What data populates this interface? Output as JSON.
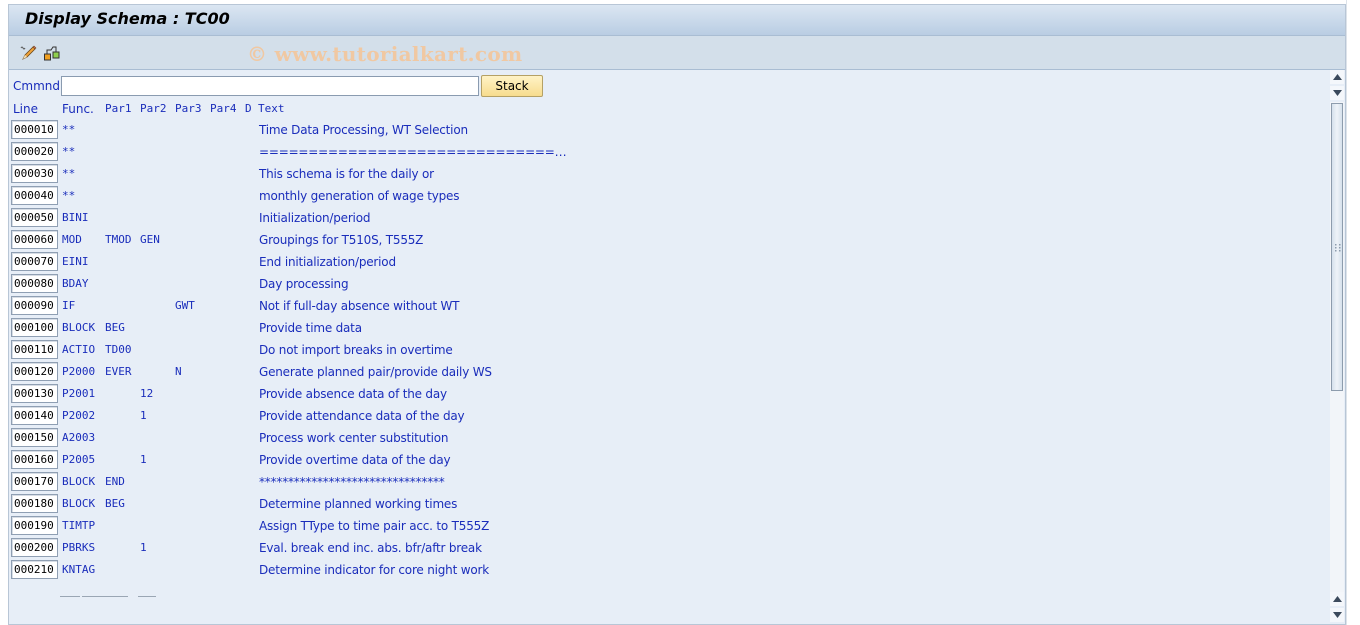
{
  "window": {
    "title": "Display Schema : TC00",
    "watermark": "© www.tutorialkart.com"
  },
  "toolbar": {
    "icons": [
      "edit-pencil-icon",
      "hierarchy-structure-icon"
    ]
  },
  "command": {
    "label": "Cmmnd",
    "value": "",
    "placeholder": "",
    "stack_button": "Stack"
  },
  "table": {
    "headers": {
      "line": "Line",
      "func": "Func.",
      "par1": "Par1",
      "par2": "Par2",
      "par3": "Par3",
      "par4": "Par4",
      "d": "D",
      "text": "Text"
    },
    "rows": [
      {
        "line": "000010",
        "func": "**",
        "par1": "",
        "par2": "",
        "par3": "",
        "par4": "",
        "d": "",
        "text": "Time Data Processing, WT Selection"
      },
      {
        "line": "000020",
        "func": "**",
        "par1": "",
        "par2": "",
        "par3": "",
        "par4": "",
        "d": "",
        "text": "==============================…"
      },
      {
        "line": "000030",
        "func": "**",
        "par1": "",
        "par2": "",
        "par3": "",
        "par4": "",
        "d": "",
        "text": "This schema is for the daily or"
      },
      {
        "line": "000040",
        "func": "**",
        "par1": "",
        "par2": "",
        "par3": "",
        "par4": "",
        "d": "",
        "text": "monthly generation of wage types"
      },
      {
        "line": "000050",
        "func": "BINI",
        "par1": "",
        "par2": "",
        "par3": "",
        "par4": "",
        "d": "",
        "text": "Initialization/period"
      },
      {
        "line": "000060",
        "func": "MOD",
        "par1": "TMOD",
        "par2": "GEN",
        "par3": "",
        "par4": "",
        "d": "",
        "text": "Groupings for T510S, T555Z"
      },
      {
        "line": "000070",
        "func": "EINI",
        "par1": "",
        "par2": "",
        "par3": "",
        "par4": "",
        "d": "",
        "text": "End initialization/period"
      },
      {
        "line": "000080",
        "func": "BDAY",
        "par1": "",
        "par2": "",
        "par3": "",
        "par4": "",
        "d": "",
        "text": "Day processing"
      },
      {
        "line": "000090",
        "func": "IF",
        "par1": "",
        "par2": "",
        "par3": "GWT",
        "par4": "",
        "d": "",
        "text": "Not if full-day absence without WT"
      },
      {
        "line": "000100",
        "func": "BLOCK",
        "par1": "BEG",
        "par2": "",
        "par3": "",
        "par4": "",
        "d": "",
        "text": "Provide time data"
      },
      {
        "line": "000110",
        "func": "ACTIO",
        "par1": "TD00",
        "par2": "",
        "par3": "",
        "par4": "",
        "d": "",
        "text": "Do not import breaks in overtime"
      },
      {
        "line": "000120",
        "func": "P2000",
        "par1": "EVER",
        "par2": "",
        "par3": "N",
        "par4": "",
        "d": "",
        "text": "Generate planned pair/provide daily WS"
      },
      {
        "line": "000130",
        "func": "P2001",
        "par1": "",
        "par2": "12",
        "par3": "",
        "par4": "",
        "d": "",
        "text": "Provide absence data of the day"
      },
      {
        "line": "000140",
        "func": "P2002",
        "par1": "",
        "par2": "1",
        "par3": "",
        "par4": "",
        "d": "",
        "text": "Provide attendance data of the day"
      },
      {
        "line": "000150",
        "func": "A2003",
        "par1": "",
        "par2": "",
        "par3": "",
        "par4": "",
        "d": "",
        "text": "Process work center substitution"
      },
      {
        "line": "000160",
        "func": "P2005",
        "par1": "",
        "par2": "1",
        "par3": "",
        "par4": "",
        "d": "",
        "text": "Provide overtime data of the day"
      },
      {
        "line": "000170",
        "func": "BLOCK",
        "par1": "END",
        "par2": "",
        "par3": "",
        "par4": "",
        "d": "",
        "text": "********************************"
      },
      {
        "line": "000180",
        "func": "BLOCK",
        "par1": "BEG",
        "par2": "",
        "par3": "",
        "par4": "",
        "d": "",
        "text": "Determine planned working times"
      },
      {
        "line": "000190",
        "func": "TIMTP",
        "par1": "",
        "par2": "",
        "par3": "",
        "par4": "",
        "d": "",
        "text": "Assign TType to time pair acc. to T555Z"
      },
      {
        "line": "000200",
        "func": "PBRKS",
        "par1": "",
        "par2": "1",
        "par3": "",
        "par4": "",
        "d": "",
        "text": "Eval. break end inc. abs. bfr/aftr break"
      },
      {
        "line": "000210",
        "func": "KNTAG",
        "par1": "",
        "par2": "",
        "par3": "",
        "par4": "",
        "d": "",
        "text": "Determine indicator for core night work"
      }
    ]
  },
  "scrollbar": {
    "up_icon": "scroll-up-arrow-icon",
    "down_icon": "scroll-down-arrow-icon"
  }
}
